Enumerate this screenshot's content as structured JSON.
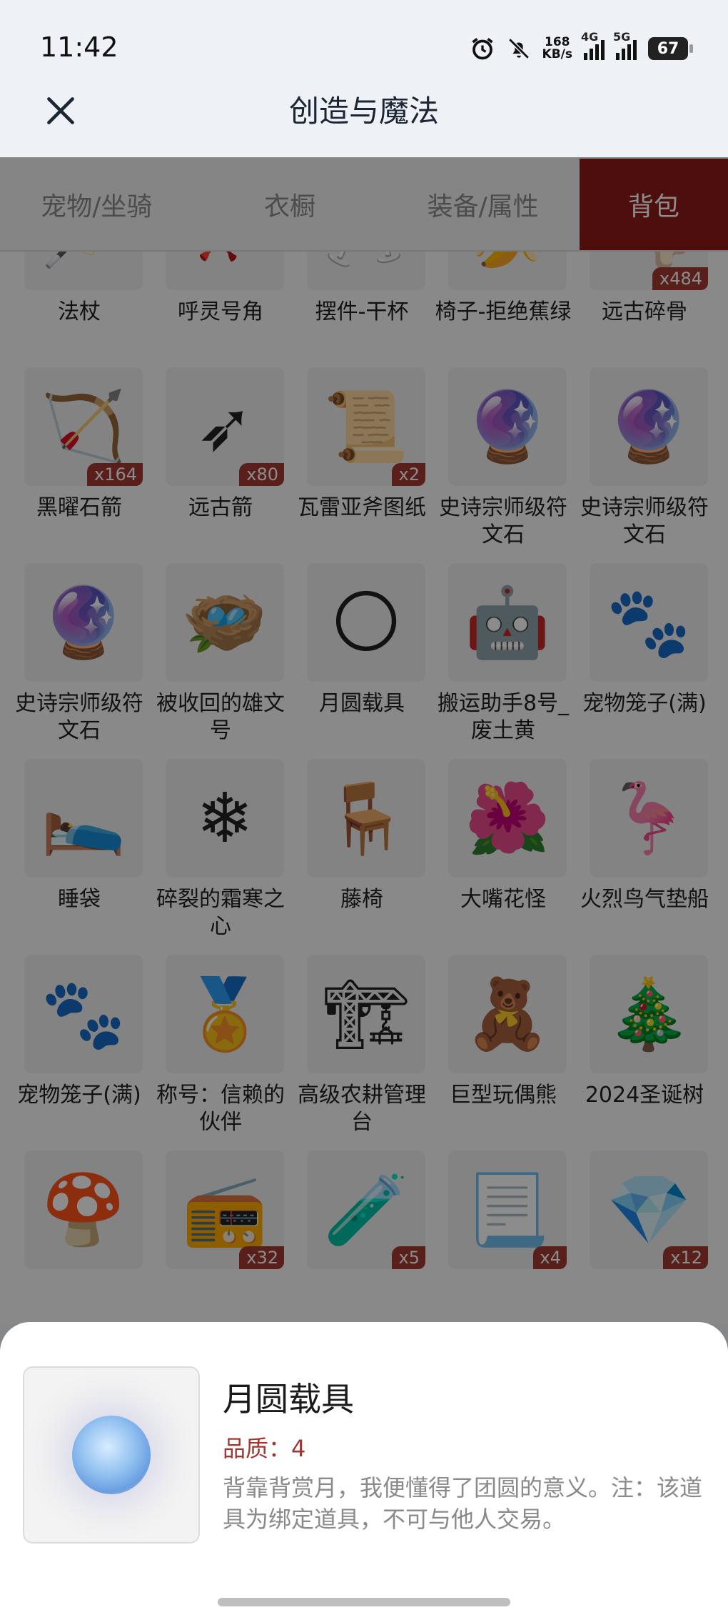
{
  "status_bar": {
    "time": "11:42",
    "net_speed_value": "168",
    "net_speed_unit": "KB/s",
    "signal1": "4G",
    "signal2": "5G",
    "battery": "67",
    "icons": [
      "alarm-icon",
      "bell-muted-icon"
    ]
  },
  "header": {
    "title": "创造与魔法",
    "close_icon": "close-icon"
  },
  "tabs": [
    {
      "label": "宠物/坐骑",
      "active": false
    },
    {
      "label": "衣橱",
      "active": false
    },
    {
      "label": "装备/属性",
      "active": false
    },
    {
      "label": "背包",
      "active": true
    }
  ],
  "items": [
    {
      "name": "法杖",
      "icon": "🪄",
      "qty": ""
    },
    {
      "name": "呼灵号角",
      "icon": "📯",
      "qty": ""
    },
    {
      "name": "摆件-干杯",
      "icon": "🥂",
      "qty": ""
    },
    {
      "name": "椅子-拒绝蕉绿",
      "icon": "🍌",
      "qty": ""
    },
    {
      "name": "远古碎骨",
      "icon": "🦴",
      "qty": "x484"
    },
    {
      "name": "黑曜石箭",
      "icon": "🏹",
      "qty": "x164"
    },
    {
      "name": "远古箭",
      "icon": "➶",
      "qty": "x80"
    },
    {
      "name": "瓦雷亚斧图纸",
      "icon": "📜",
      "qty": "x2"
    },
    {
      "name": "史诗宗师级符文石",
      "icon": "🔮",
      "qty": ""
    },
    {
      "name": "史诗宗师级符文石",
      "icon": "🔮",
      "qty": ""
    },
    {
      "name": "史诗宗师级符文石",
      "icon": "🔮",
      "qty": ""
    },
    {
      "name": "被收回的雄文号",
      "icon": "🪺",
      "qty": ""
    },
    {
      "name": "月圆载具",
      "icon": "🌕",
      "qty": ""
    },
    {
      "name": "搬运助手8号_废土黄",
      "icon": "🤖",
      "qty": ""
    },
    {
      "name": "宠物笼子(满)",
      "icon": "🐾",
      "qty": ""
    },
    {
      "name": "睡袋",
      "icon": "🛌",
      "qty": ""
    },
    {
      "name": "碎裂的霜寒之心",
      "icon": "❄",
      "qty": ""
    },
    {
      "name": "藤椅",
      "icon": "🪑",
      "qty": ""
    },
    {
      "name": "大嘴花怪",
      "icon": "🌺",
      "qty": ""
    },
    {
      "name": "火烈鸟气垫船",
      "icon": "🦩",
      "qty": ""
    },
    {
      "name": "宠物笼子(满)",
      "icon": "🐾",
      "qty": ""
    },
    {
      "name": "称号：信赖的伙伴",
      "icon": "🏅",
      "qty": ""
    },
    {
      "name": "高级农耕管理台",
      "icon": "🏗",
      "qty": ""
    },
    {
      "name": "巨型玩偶熊",
      "icon": "🧸",
      "qty": ""
    },
    {
      "name": "2024圣诞树",
      "icon": "🎄",
      "qty": ""
    },
    {
      "name": "",
      "icon": "🍄",
      "qty": ""
    },
    {
      "name": "",
      "icon": "📻",
      "qty": "x32"
    },
    {
      "name": "",
      "icon": "🧪",
      "qty": "x5"
    },
    {
      "name": "",
      "icon": "📃",
      "qty": "x4"
    },
    {
      "name": "",
      "icon": "💎",
      "qty": "x12"
    }
  ],
  "detail": {
    "name": "月圆载具",
    "quality": "品质：4",
    "description": "背靠背赏月，我便懂得了团圆的意义。注：该道具为绑定道具，不可与他人交易。"
  }
}
